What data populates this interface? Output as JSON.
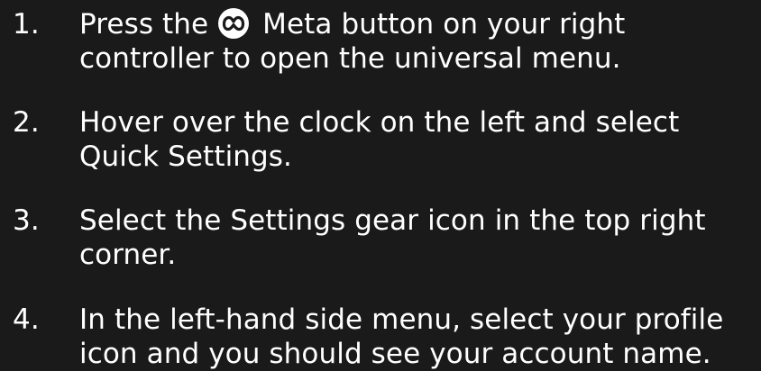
{
  "steps": [
    {
      "number": "1.",
      "line1_before_icon": "Press the ",
      "icon": "meta-logo-icon",
      "line1_after_icon": " Meta button on your right",
      "line2": "controller to open the universal menu."
    },
    {
      "number": "2.",
      "line1": "Hover over the clock on the left and select",
      "line2": "Quick Settings."
    },
    {
      "number": "3.",
      "line1": "Select the Settings gear icon in the top right",
      "line2": "corner."
    },
    {
      "number": "4.",
      "line1": "In the left-hand side menu, select your profile",
      "line2": "icon and you should see your account name."
    }
  ],
  "colors": {
    "background": "#1a1a1a",
    "text": "#ffffff"
  }
}
